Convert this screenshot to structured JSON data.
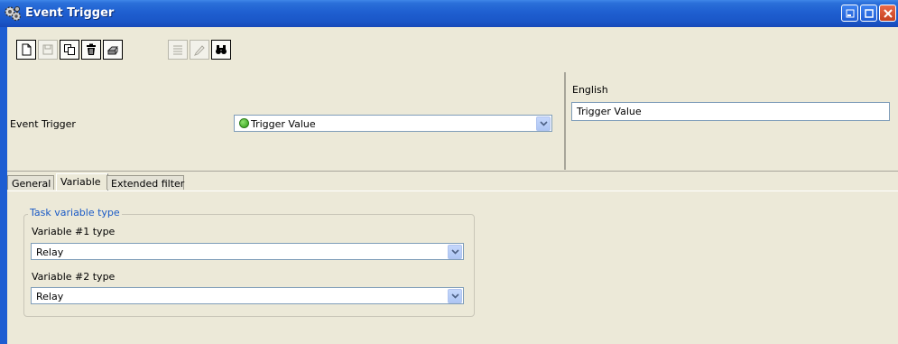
{
  "window": {
    "title": "Event Trigger",
    "app_icon": "gear-cluster-icon",
    "controls": [
      "minimize-icon",
      "maximize-icon",
      "close-icon"
    ]
  },
  "toolbar": {
    "buttons": [
      {
        "name": "new-document-icon",
        "enabled": true
      },
      {
        "name": "save-icon",
        "enabled": false
      },
      {
        "name": "copy-icon",
        "enabled": true
      },
      {
        "name": "delete-trash-icon",
        "enabled": true
      },
      {
        "name": "print-icon",
        "enabled": true
      },
      {
        "name": "list-icon",
        "enabled": false
      },
      {
        "name": "edit-pencil-icon",
        "enabled": false
      },
      {
        "name": "search-binoculars-icon",
        "enabled": true
      }
    ]
  },
  "form": {
    "event_trigger_label": "Event Trigger",
    "event_trigger_value": "Trigger Value",
    "status_color": "#2b9a13",
    "language_label": "English",
    "language_value": "Trigger Value"
  },
  "tabs": [
    {
      "label": "General",
      "active": false
    },
    {
      "label": "Variable",
      "active": true
    },
    {
      "label": "Extended filter",
      "active": false
    }
  ],
  "task_variable": {
    "group_title": "Task variable type",
    "var1_label": "Variable #1 type",
    "var1_value": "Relay",
    "var2_label": "Variable #2 type",
    "var2_value": "Relay"
  },
  "colors": {
    "titlebar": "#1f5fd0",
    "face": "#ece9d8",
    "close_button": "#c6401f",
    "group_title": "#1a5ac6"
  }
}
